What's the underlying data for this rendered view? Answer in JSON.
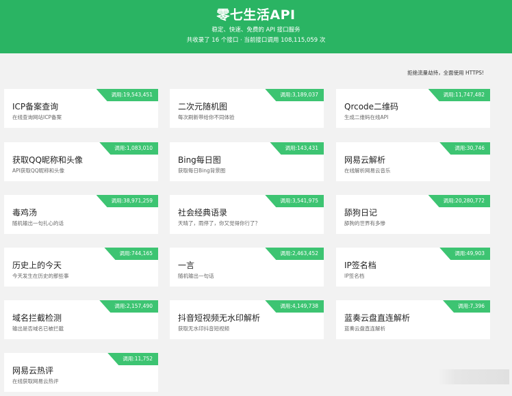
{
  "header": {
    "title": "零七生活API",
    "subtitle": "稳定、快速、免费的 API 接口服务",
    "stats": "共收录了 16 个接口 · 当前接口调用 108,115,059 次"
  },
  "notice": "拒绝流量劫持，全面使用 HTTPS!",
  "cards": [
    {
      "title": "ICP备案查询",
      "desc": "在线查询网站ICP备案",
      "calls": "调用:19,543,451"
    },
    {
      "title": "二次元随机图",
      "desc": "每次刷新带给你不同体验",
      "calls": "调用:3,189,037"
    },
    {
      "title": "Qrcode二维码",
      "desc": "生成二维码在线API",
      "calls": "调用:11,747,482"
    },
    {
      "title": "获取QQ昵称和头像",
      "desc": "API获取QQ昵称和头像",
      "calls": "调用:1,083,010"
    },
    {
      "title": "Bing每日图",
      "desc": "获取每日Bing背景图",
      "calls": "调用:143,431"
    },
    {
      "title": "网易云解析",
      "desc": "在线解析网易云音乐",
      "calls": "调用:30,746"
    },
    {
      "title": "毒鸡汤",
      "desc": "随机输出一句扎心的话",
      "calls": "调用:38,971,259"
    },
    {
      "title": "社会经典语录",
      "desc": "天晴了，雨停了，你又觉得你行了？",
      "calls": "调用:3,541,975"
    },
    {
      "title": "舔狗日记",
      "desc": "舔狗的世界有多惨",
      "calls": "调用:20,280,772"
    },
    {
      "title": "历史上的今天",
      "desc": "今天发生在历史的那些事",
      "calls": "调用:744,165"
    },
    {
      "title": "一言",
      "desc": "随机输出一句话",
      "calls": "调用:2,463,452"
    },
    {
      "title": "IP签名档",
      "desc": "IP签名档",
      "calls": "调用:49,903"
    },
    {
      "title": "域名拦截检测",
      "desc": "输出是否域名已被拦截",
      "calls": "调用:2,157,490"
    },
    {
      "title": "抖音短视频无水印解析",
      "desc": "获取无水印抖音短视频",
      "calls": "调用:4,149,738"
    },
    {
      "title": "蓝奏云盘直连解析",
      "desc": "蓝奏云盘直连解析",
      "calls": "调用:7,396"
    },
    {
      "title": "网易云热评",
      "desc": "在线获取网易云热评",
      "calls": "调用:11,752"
    }
  ]
}
